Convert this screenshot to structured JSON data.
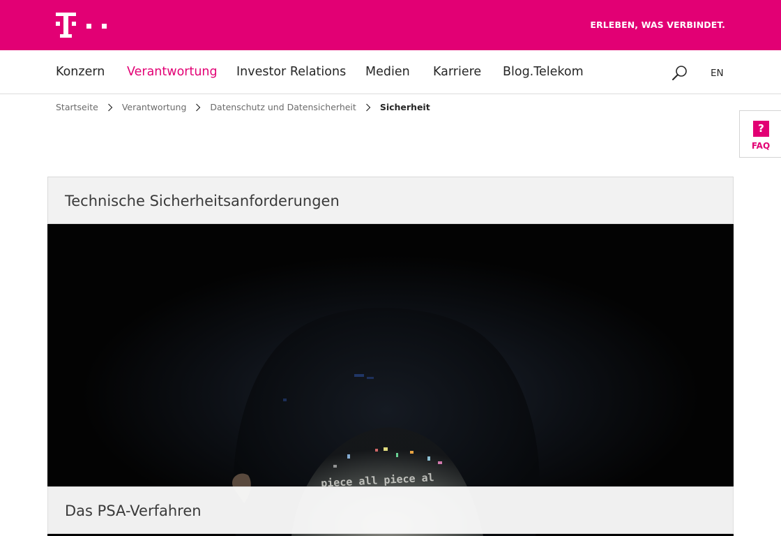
{
  "brand": {
    "logo_icon": "telekom-t-logo",
    "claim": "ERLEBEN, WAS VERBINDET.",
    "color": "#e20074"
  },
  "nav": {
    "items": [
      {
        "label": "Konzern"
      },
      {
        "label": "Verantwortung",
        "active": true
      },
      {
        "label": "Investor Relations"
      },
      {
        "label": "Medien"
      },
      {
        "label": "Karriere"
      },
      {
        "label": "Blog.Telekom"
      }
    ],
    "search_icon": "search-icon",
    "language": "EN"
  },
  "breadcrumb": {
    "items": [
      "Startseite",
      "Verantwortung",
      "Datenschutz und Datensicherheit"
    ],
    "current": "Sicherheit"
  },
  "faq": {
    "icon": "?",
    "label": "FAQ"
  },
  "module": {
    "title": "Technische Sicherheitsanforderungen",
    "image_overlay_text": "piece all piece al",
    "teaser_title": "Das PSA-Verfahren"
  }
}
